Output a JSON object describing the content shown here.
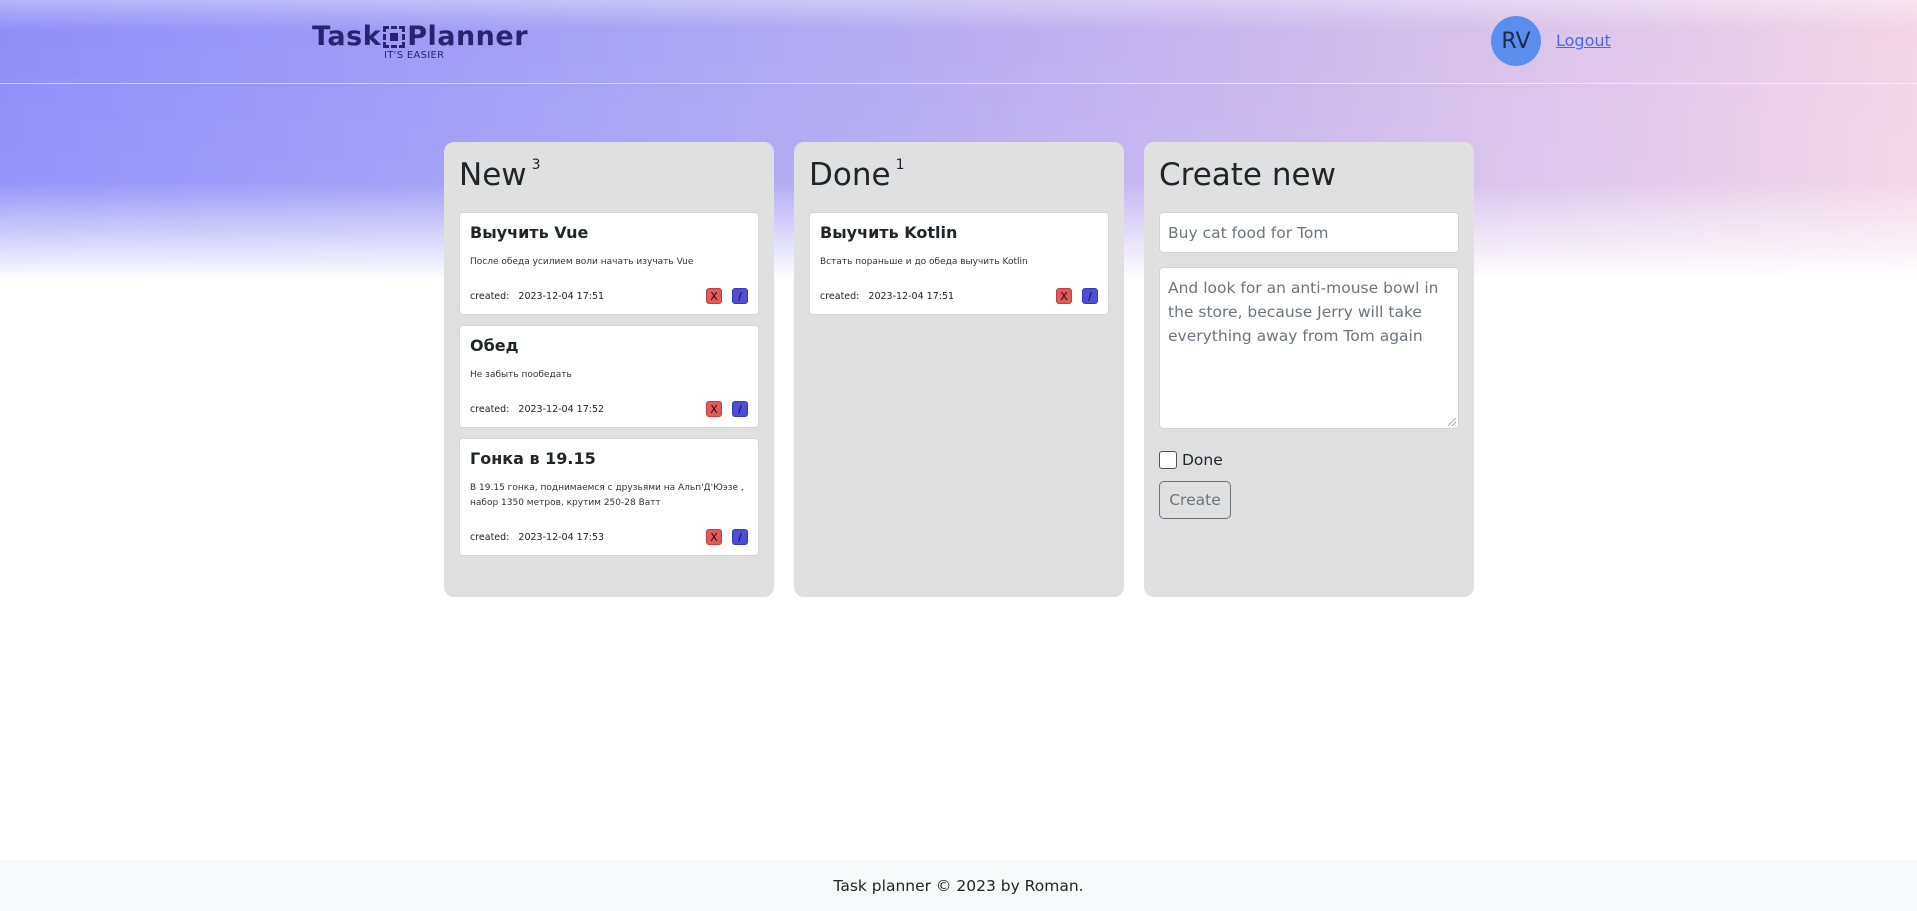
{
  "app": {
    "logo_text_left": "Task",
    "logo_text_right": "Planner",
    "logo_tagline": "IT'S EASIER"
  },
  "user": {
    "initials": "RV",
    "logout_label": "Logout"
  },
  "columns": {
    "new": {
      "title": "New",
      "count": "3",
      "tasks": [
        {
          "title": "Выучить Vue",
          "description": "После обеда усилием воли начать изучать Vue",
          "created_label": "created:",
          "created": "2023-12-04 17:51",
          "delete_label": "X",
          "edit_label": "/"
        },
        {
          "title": "Обед",
          "description": "Не забыть пообедать",
          "created_label": "created:",
          "created": "2023-12-04 17:52",
          "delete_label": "X",
          "edit_label": "/"
        },
        {
          "title": "Гонка в 19.15",
          "description": "В 19.15 гонка, поднимаемся с друзьями на Альп'Д'Юэзе , набор 1350 метров, крутим 250-28 Ватт",
          "created_label": "created:",
          "created": "2023-12-04 17:53",
          "delete_label": "X",
          "edit_label": "/"
        }
      ]
    },
    "done": {
      "title": "Done",
      "count": "1",
      "tasks": [
        {
          "title": "Выучить Kotlin",
          "description": "Встать пораньше и до обеда выучить Kotlin",
          "created_label": "created:",
          "created": "2023-12-04 17:51",
          "delete_label": "X",
          "edit_label": "/"
        }
      ]
    }
  },
  "create_form": {
    "title": "Create new",
    "title_placeholder": "Buy cat food for Tom",
    "description_placeholder": "And look for an anti-mouse bowl in the store, because Jerry will take everything away from Tom again",
    "done_label": "Done",
    "done_checked": false,
    "create_label": "Create"
  },
  "footer": {
    "text": "Task planner © 2023 by Roman."
  },
  "colors": {
    "accent": "#4b68e8",
    "avatar_bg": "#5b8def",
    "delete_btn": "#e05a5a",
    "edit_btn": "#4f4ed6",
    "column_bg": "#e0e0e0",
    "logo": "#2a2370"
  }
}
